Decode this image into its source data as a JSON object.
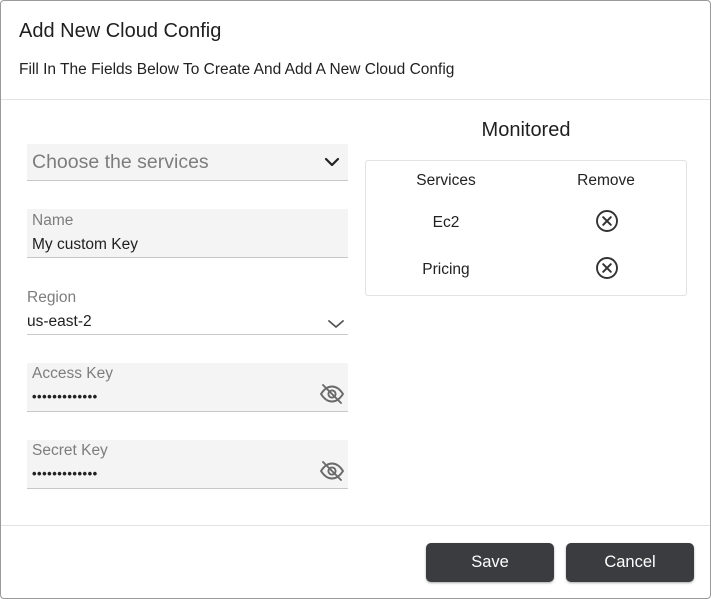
{
  "dialog": {
    "title": "Add New Cloud Config",
    "subtitle": "Fill In The Fields Below To Create And Add A New Cloud Config"
  },
  "form": {
    "services_placeholder": "Choose the services",
    "name": {
      "label": "Name",
      "value": "My custom Key"
    },
    "region": {
      "label": "Region",
      "value": "us-east-2"
    },
    "access_key": {
      "label": "Access Key",
      "value": "•••••••••••••"
    },
    "secret_key": {
      "label": "Secret Key",
      "value": "•••••••••••••"
    }
  },
  "monitored": {
    "title": "Monitored",
    "columns": {
      "services": "Services",
      "remove": "Remove"
    },
    "rows": [
      {
        "service": "Ec2"
      },
      {
        "service": "Pricing"
      }
    ]
  },
  "footer": {
    "save_label": "Save",
    "cancel_label": "Cancel"
  },
  "icons": {
    "chevron": "chevron-down-icon",
    "visibility": "eye-off-icon",
    "remove": "close-circle-icon"
  },
  "colors": {
    "button_bg": "#3b3c3f",
    "field_bg": "#f4f4f4",
    "border": "#e3e3e3"
  }
}
